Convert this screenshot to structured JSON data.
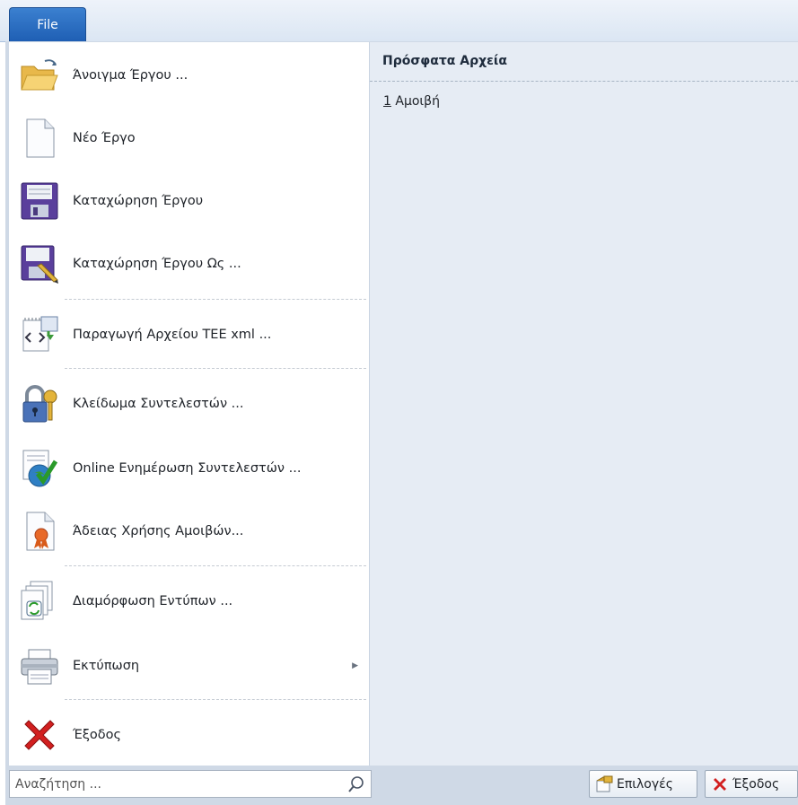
{
  "ribbon": {
    "file_tab": "File"
  },
  "menu": {
    "items": [
      {
        "label": "Άνοιγμα Έργου ...",
        "icon": "open-folder-icon"
      },
      {
        "label": "Νέο Έργο",
        "icon": "new-document-icon"
      },
      {
        "label": "Καταχώρηση Έργου",
        "icon": "save-disk-icon"
      },
      {
        "label": "Καταχώρηση Έργου Ως ...",
        "icon": "save-as-icon"
      },
      {
        "label": "Παραγωγή Αρχείου TEE xml ...",
        "icon": "xml-export-icon"
      },
      {
        "label": "Κλείδωμα Συντελεστών ...",
        "icon": "lock-key-icon"
      },
      {
        "label": "Online Ενημέρωση Συντελεστών ...",
        "icon": "online-update-icon"
      },
      {
        "label": "Άδειας Χρήσης Αμοιβών...",
        "icon": "license-certificate-icon"
      },
      {
        "label": "Διαμόρφωση Εντύπων ...",
        "icon": "forms-refresh-icon"
      },
      {
        "label": "Εκτύπωση",
        "icon": "printer-icon",
        "submenu": true
      },
      {
        "label": "Έξοδος",
        "icon": "exit-x-icon"
      }
    ]
  },
  "recent": {
    "title": "Πρόσφατα Αρχεία",
    "items": [
      {
        "index": "1",
        "name": "Αμοιβή"
      }
    ]
  },
  "footer": {
    "search_placeholder": "Αναζήτηση ...",
    "options_label": "Επιλογές",
    "exit_label": "Έξοδος"
  },
  "colors": {
    "file_tab": "#1f5fb4",
    "menu_background": "#ffffff",
    "recent_panel": "#e6ecf4",
    "footer_bar": "#cfd9e6",
    "exit_red": "#d21f1f"
  }
}
